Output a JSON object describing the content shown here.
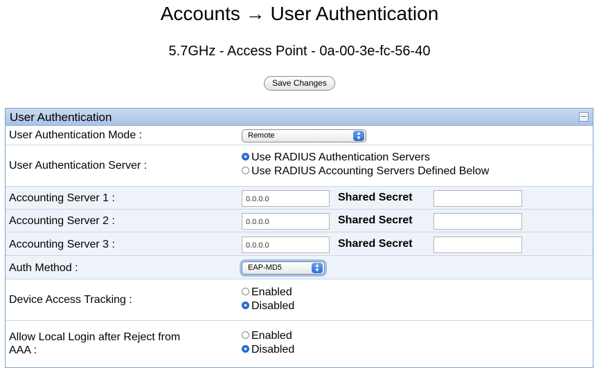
{
  "header": {
    "title": "Accounts → User Authentication",
    "subtitle": "5.7GHz - Access Point - 0a-00-3e-fc-56-40",
    "save_label": "Save Changes"
  },
  "panel": {
    "title": "User Authentication",
    "collapse_icon": "minus-square-icon",
    "mode": {
      "label": "User Authentication Mode :",
      "selected": "Remote"
    },
    "server": {
      "label": "User Authentication Server :",
      "option1": "Use RADIUS Authentication Servers",
      "option2": "Use RADIUS Accounting Servers Defined Below",
      "selected": 1
    },
    "acct_servers": [
      {
        "label": "Accounting Server 1 :",
        "value": "0.0.0.0",
        "secret_label": "Shared Secret",
        "secret_value": ""
      },
      {
        "label": "Accounting Server 2 :",
        "value": "0.0.0.0",
        "secret_label": "Shared Secret",
        "secret_value": ""
      },
      {
        "label": "Accounting Server 3 :",
        "value": "0.0.0.0",
        "secret_label": "Shared Secret",
        "secret_value": ""
      }
    ],
    "auth_method": {
      "label": "Auth Method :",
      "selected": "EAP-MD5"
    },
    "tracking": {
      "label": "Device Access Tracking :",
      "enabled": "Enabled",
      "disabled": "Disabled",
      "selected": "Disabled"
    },
    "local_login": {
      "label_line1": "Allow Local Login after Reject from",
      "label_line2": "AAA :",
      "enabled": "Enabled",
      "disabled": "Disabled",
      "selected": "Disabled"
    }
  },
  "colors": {
    "header_bg": "#b8cdea",
    "border": "#7aa0c8",
    "radio_selected": "#2c6fd6"
  }
}
